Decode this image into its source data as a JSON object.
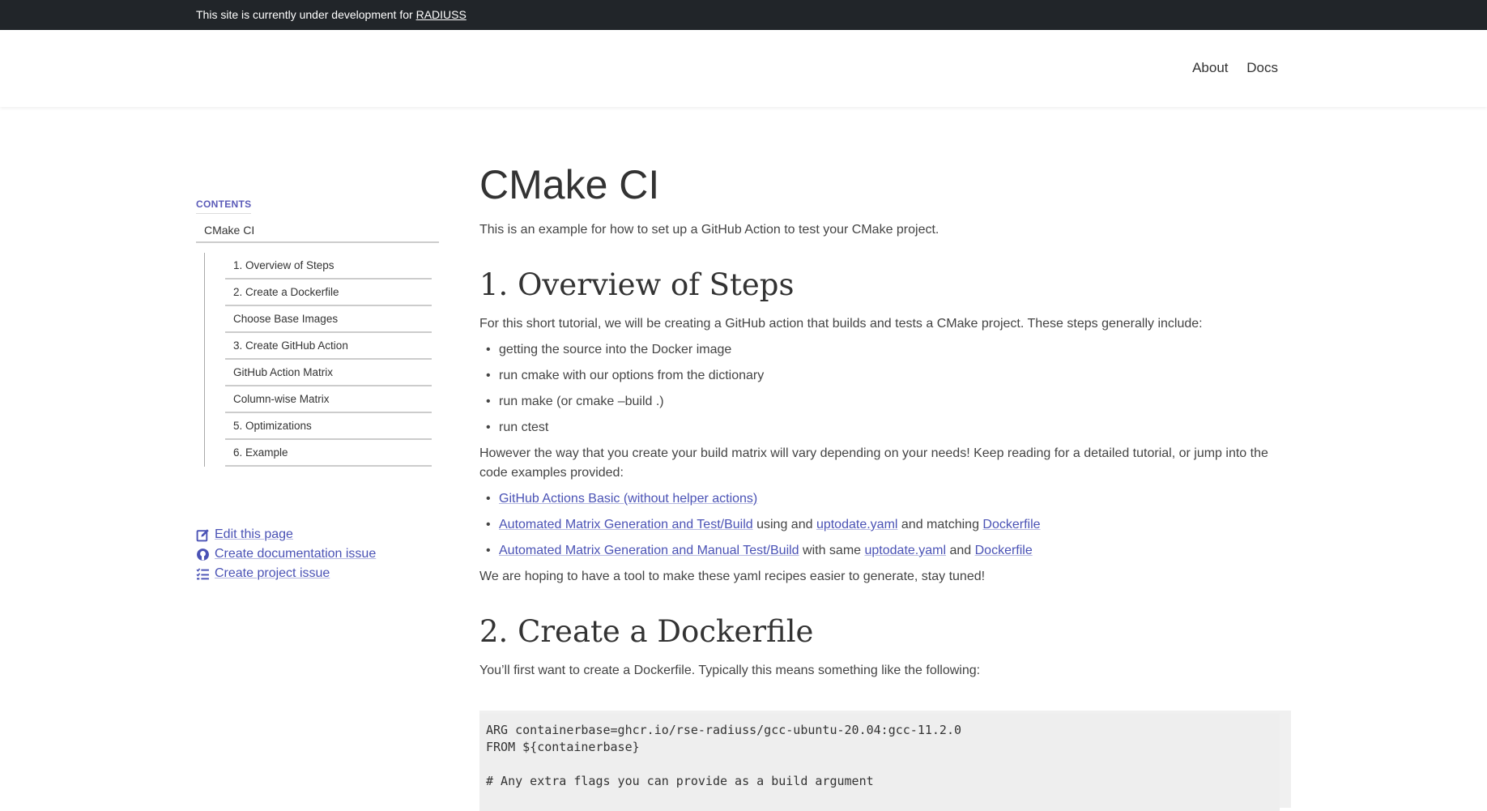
{
  "topbar": {
    "text": "This site is currently under development for ",
    "link": "RADIUSS"
  },
  "nav": {
    "about": "About",
    "docs": "Docs"
  },
  "sidebar": {
    "contents_label": "CONTENTS",
    "top_item": "CMake CI",
    "items": [
      "1. Overview of Steps",
      "2. Create a Dockerfile",
      "Choose Base Images",
      "3. Create GitHub Action",
      "GitHub Action Matrix",
      "Column-wise Matrix",
      "5. Optimizations",
      "6. Example"
    ],
    "links": {
      "edit": "Edit this page",
      "doc_issue": "Create documentation issue",
      "project_issue": "Create project issue"
    }
  },
  "main": {
    "title": "CMake CI",
    "intro": "This is an example for how to set up a GitHub Action to test your CMake project.",
    "overview": {
      "heading": "1. Overview of Steps",
      "para": "For this short tutorial, we will be creating a GitHub action that builds and tests a CMake project. These steps generally include:",
      "steps": [
        "getting the source into the Docker image",
        "run cmake with our options from the dictionary",
        "run make (or cmake –build .)",
        "run ctest"
      ],
      "para2": "However the way that you create your build matrix will vary depending on your needs! Keep reading for a detailed tutorial, or jump into the code examples provided:",
      "ex1_link": "GitHub Actions Basic (without helper actions)",
      "ex2_link1": "Automated Matrix Generation and Test/Build",
      "ex2_t1": " using and ",
      "ex2_link2": "uptodate.yaml",
      "ex2_t2": " and matching ",
      "ex2_link3": "Dockerfile",
      "ex3_link1": "Automated Matrix Generation and Manual Test/Build",
      "ex3_t1": " with same ",
      "ex3_link2": "uptodate.yaml",
      "ex3_t2": " and ",
      "ex3_link3": "Dockerfile",
      "para3": "We are hoping to have a tool to make these yaml recipes easier to generate, stay tuned!"
    },
    "dockerfile": {
      "heading": "2. Create a Dockerfile",
      "para": "You’ll first want to create a Dockerfile. Typically this means something like the following:",
      "code_line1": "ARG containerbase=ghcr.io/rse-radiuss/gcc-ubuntu-20.04:gcc-11.2.0",
      "code_line2": "FROM ${containerbase}",
      "code_line3": "",
      "code_line4": "# Any extra flags you can provide as a build argument"
    }
  }
}
